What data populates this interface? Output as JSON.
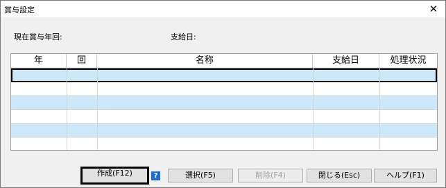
{
  "window": {
    "title": "賞与設定",
    "close_glyph": "✕"
  },
  "info": {
    "current_label": "現在賞与年回:",
    "payday_label": "支給日:"
  },
  "table": {
    "columns": [
      "年",
      "回",
      "名称",
      "支給日",
      "処理状況"
    ]
  },
  "buttons": {
    "create": "作成(F12)",
    "help_glyph": "?",
    "select": "選択(F5)",
    "delete": "削除(F4)",
    "close": "閉じる(Esc)",
    "help": "ヘルプ(F1)"
  }
}
